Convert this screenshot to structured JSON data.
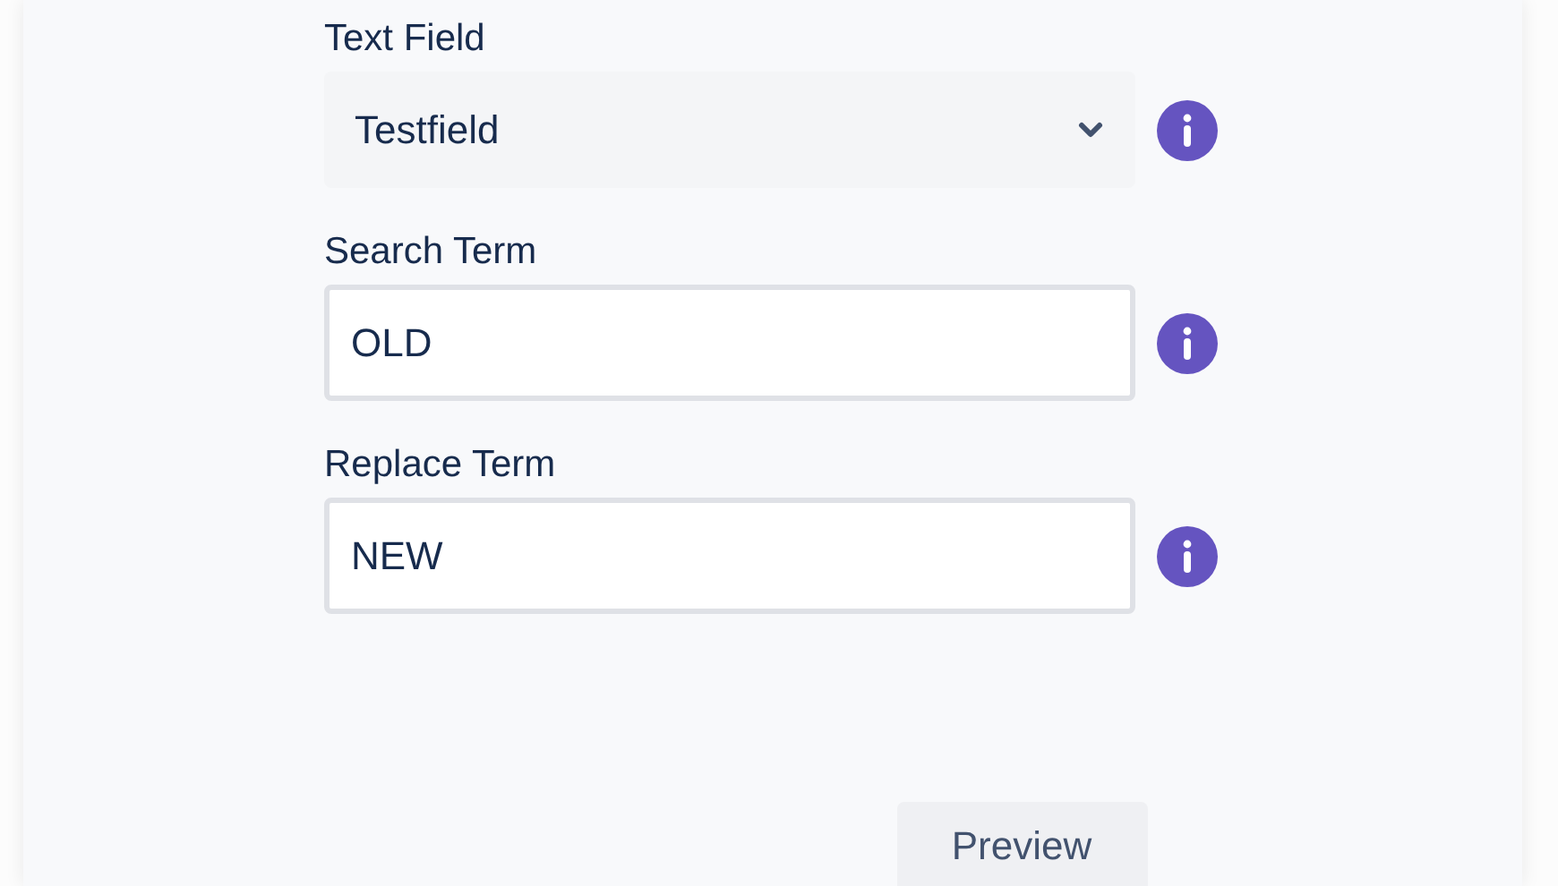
{
  "fields": [
    {
      "kind": "select",
      "label": "Text Field",
      "value": "Testfield"
    },
    {
      "kind": "text",
      "label": "Search Term",
      "value": "OLD"
    },
    {
      "kind": "text",
      "label": "Replace Term",
      "value": "NEW"
    }
  ],
  "buttons": [
    "Preview"
  ]
}
